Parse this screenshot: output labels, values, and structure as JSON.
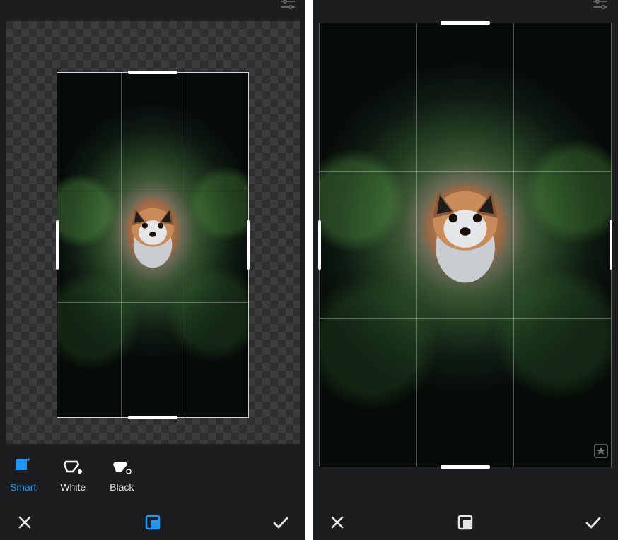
{
  "fill_options": {
    "smart": "Smart",
    "white": "White",
    "black": "Black",
    "active": "smart"
  },
  "icons": {
    "close": "close-icon",
    "confirm": "check-icon",
    "expand": "expand-icon",
    "sliders": "sliders-icon",
    "sparkle_fill": "sparkle-fill-icon",
    "bucket_white": "bucket-white-icon",
    "bucket_black": "bucket-black-icon",
    "star": "star-icon"
  },
  "left_panel": {
    "has_checker_background": true,
    "crop_handles_visible": true,
    "grid_thirds_visible": true
  },
  "right_panel": {
    "has_checker_background": false,
    "crop_handles_visible": true,
    "grid_thirds_visible": true,
    "star_badge_visible": true
  }
}
